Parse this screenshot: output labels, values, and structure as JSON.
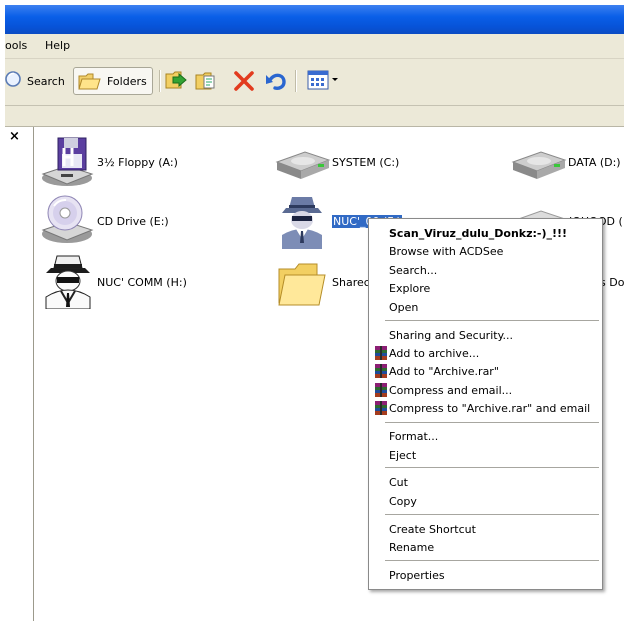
{
  "menu": {
    "tools": "ools",
    "help": "Help"
  },
  "toolbar": {
    "search": "Search",
    "folders": "Folders"
  },
  "left_pane": {
    "close": "×"
  },
  "drives": [
    {
      "label": "3½ Floppy (A:)",
      "icon": "floppy-drive-icon"
    },
    {
      "label": "SYSTEM (C:)",
      "icon": "hard-drive-icon"
    },
    {
      "label": "DATA (D:)",
      "icon": "hard-drive-icon"
    },
    {
      "label": "CD Drive (E:)",
      "icon": "cd-drive-icon"
    },
    {
      "label": "NUC'_00 (F:)",
      "icon": "spy-drive-icon"
    },
    {
      "label": "JOHOOD (",
      "icon": "hard-drive-icon"
    },
    {
      "label": "NUC' COMM (H:)",
      "icon": "spy-drive-icon"
    },
    {
      "label": "Sharec",
      "icon": "shared-folder-icon"
    },
    {
      "label": "s Do",
      "icon": "folder-icon"
    }
  ],
  "context_menu": {
    "items": [
      {
        "label": "Scan_Viruz_dulu_Donkz:-)_!!!",
        "bold": true
      },
      {
        "label": "Browse with ACDSee"
      },
      {
        "label": "Search..."
      },
      {
        "label": "Explore"
      },
      {
        "label": "Open"
      },
      {
        "label": "Sharing and Security..."
      },
      {
        "label": "Add to archive...",
        "icon": "winrar-icon"
      },
      {
        "label": "Add to \"Archive.rar\"",
        "icon": "winrar-icon"
      },
      {
        "label": "Compress and email...",
        "icon": "winrar-icon"
      },
      {
        "label": "Compress to \"Archive.rar\" and email",
        "icon": "winrar-icon"
      },
      {
        "label": "Format..."
      },
      {
        "label": "Eject"
      },
      {
        "label": "Cut"
      },
      {
        "label": "Copy"
      },
      {
        "label": "Create Shortcut"
      },
      {
        "label": "Rename"
      },
      {
        "label": "Properties"
      }
    ]
  },
  "colors": {
    "titlebar": "#0a5fe8",
    "chrome": "#ece9d8",
    "selection": "#316ac5"
  }
}
